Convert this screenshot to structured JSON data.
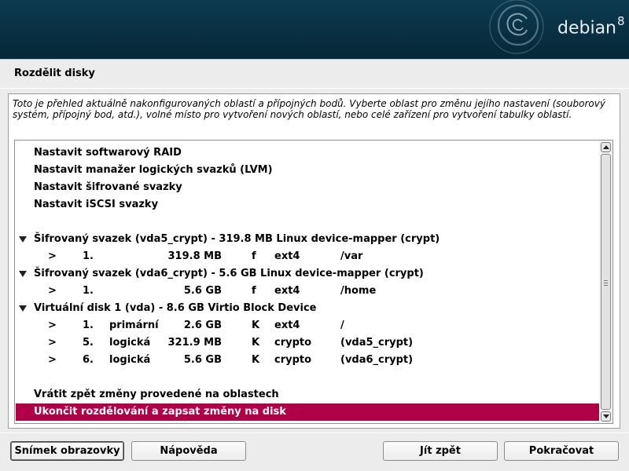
{
  "banner": {
    "brand": "debian",
    "version": "8"
  },
  "page": {
    "title": "Rozdělit disky",
    "intro": "Toto je přehled aktuálně nakonfigurovaných oblastí a přípojných bodů. Vyberte oblast pro změnu jejího nastavení (souborový systém, přípojný bod, atd.), volné místo pro vytvoření nových oblastí, nebo celé zařízení pro vytvoření tabulky oblastí."
  },
  "list": {
    "actions": [
      "Nastavit softwarový RAID",
      "Nastavit manažer logických svazků (LVM)",
      "Nastavit šifrované svazky",
      "Nastavit iSCSI svazky"
    ],
    "devices": [
      {
        "label": "Šifrovaný svazek (vda5_crypt) - 319.8 MB Linux device-mapper (crypt)",
        "partitions": [
          {
            "arrow": ">",
            "num": "1.",
            "type": "",
            "size": "319.8 MB",
            "flag": "f",
            "fs": "ext4",
            "mount": "/var"
          }
        ]
      },
      {
        "label": "Šifrovaný svazek (vda6_crypt) - 5.6 GB Linux device-mapper (crypt)",
        "partitions": [
          {
            "arrow": ">",
            "num": "1.",
            "type": "",
            "size": "5.6 GB",
            "flag": "f",
            "fs": "ext4",
            "mount": "/home"
          }
        ]
      },
      {
        "label": "Virtuální disk 1 (vda) - 8.6 GB Virtio Block Device",
        "partitions": [
          {
            "arrow": ">",
            "num": "1.",
            "type": "primární",
            "size": "2.6 GB",
            "flag": "K",
            "fs": "ext4",
            "mount": "/"
          },
          {
            "arrow": ">",
            "num": "5.",
            "type": "logická",
            "size": "321.9 MB",
            "flag": "K",
            "fs": "crypto",
            "mount": "(vda5_crypt)"
          },
          {
            "arrow": ">",
            "num": "6.",
            "type": "logická",
            "size": "5.6 GB",
            "flag": "K",
            "fs": "crypto",
            "mount": "(vda6_crypt)"
          }
        ]
      }
    ],
    "undo": "Vrátit zpět změny provedené na oblastech",
    "finish": "Ukončit rozdělování a zapsat změny na disk"
  },
  "buttons": {
    "screenshot": "Snímek obrazovky",
    "help": "Nápověda",
    "back": "Jít zpět",
    "continue": "Pokračovat"
  },
  "colors": {
    "selection": "#b00046",
    "banner": "#0a3346"
  }
}
